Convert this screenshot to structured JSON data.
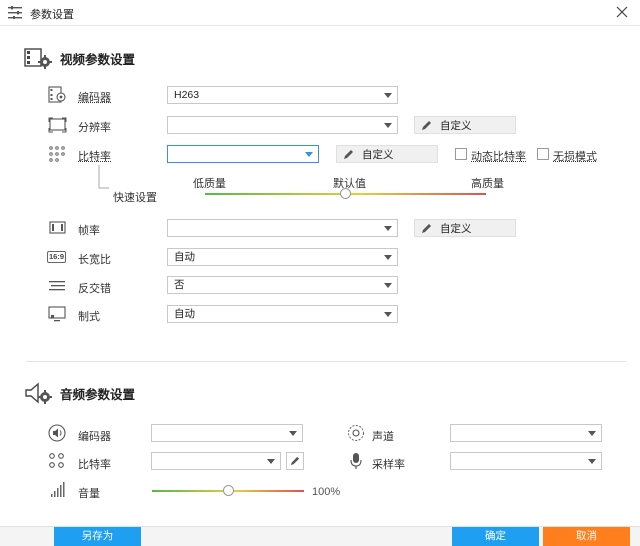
{
  "window": {
    "title": "参数设置"
  },
  "video": {
    "heading": "视频参数设置",
    "codec": {
      "label": "编码器",
      "value": "H263"
    },
    "resolution": {
      "label": "分辨率",
      "value": "",
      "custom_label": "自定义"
    },
    "bitrate": {
      "label": "比特率",
      "value": "",
      "custom_label": "自定义",
      "dynamic_label": "动态比特率",
      "lossless_label": "无损模式"
    },
    "quick": {
      "label": "快速设置",
      "low": "低质量",
      "default": "默认值",
      "high": "高质量",
      "level": 0.5
    },
    "framerate": {
      "label": "帧率",
      "value": "",
      "custom_label": "自定义"
    },
    "aspect": {
      "label": "长宽比",
      "value": "自动",
      "icon_text": "16:9"
    },
    "deinterlace": {
      "label": "反交错",
      "value": "否"
    },
    "format": {
      "label": "制式",
      "value": "自动"
    }
  },
  "audio": {
    "heading": "音频参数设置",
    "codec": {
      "label": "编码器",
      "value": ""
    },
    "channel": {
      "label": "声道",
      "value": ""
    },
    "bitrate": {
      "label": "比特率",
      "value": ""
    },
    "samplerate": {
      "label": "采样率",
      "value": ""
    },
    "volume": {
      "label": "音量",
      "value": "100%",
      "level": 0.5
    }
  },
  "footer": {
    "save_as": "另存为",
    "ok": "确定",
    "cancel": "取消"
  },
  "colors": {
    "blue": "#1e9ff2",
    "orange": "#ff7f1e",
    "accent_border": "#3a8ee6"
  }
}
